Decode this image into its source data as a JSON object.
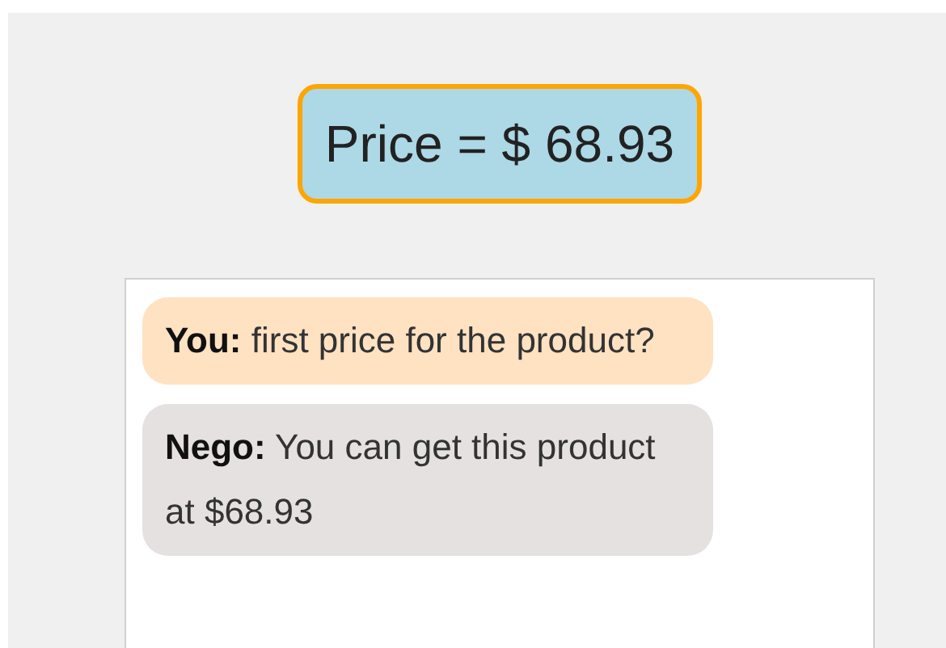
{
  "price": {
    "text": "Price = $ 68.93"
  },
  "messages": [
    {
      "kind": "user",
      "sender": "You:",
      "text": "first price for the product?"
    },
    {
      "kind": "bot",
      "sender": "Nego:",
      "text": "You can get this product at $68.93"
    }
  ]
}
